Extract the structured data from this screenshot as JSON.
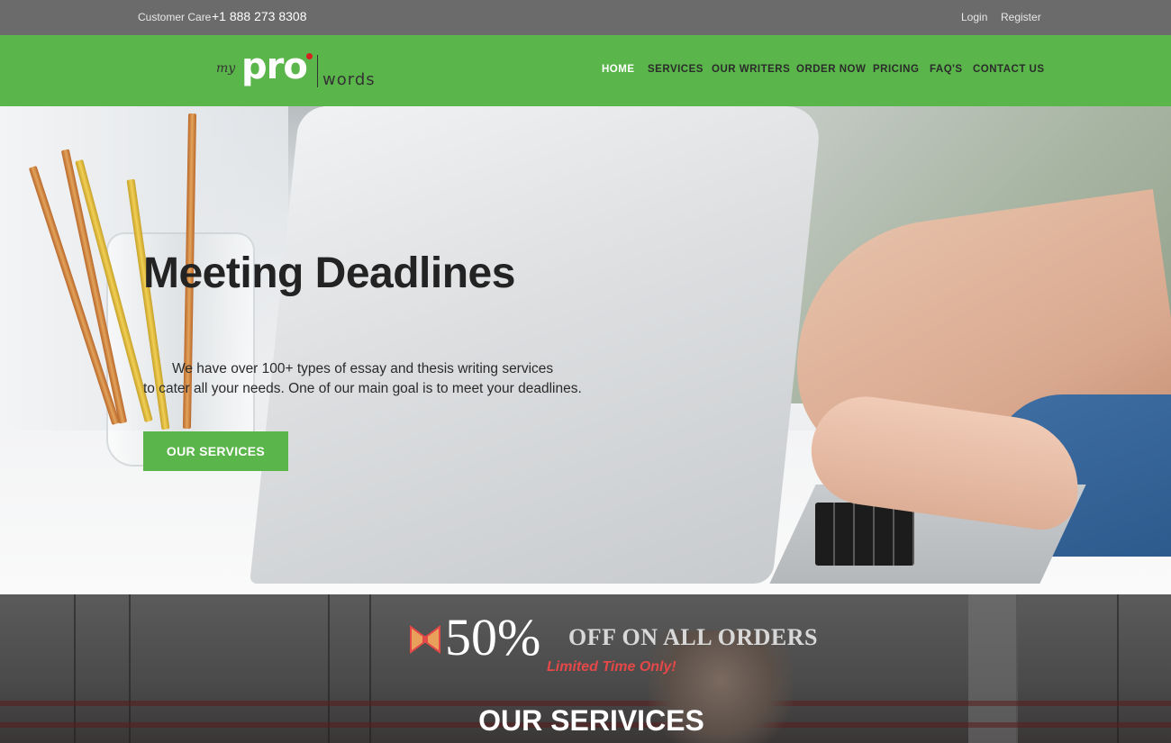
{
  "topbar": {
    "customer_care_label": "Customer Care",
    "phone": "+1 888 273 8308",
    "login": "Login",
    "register": "Register"
  },
  "logo": {
    "my": "my",
    "pro": "pro",
    "words": "words"
  },
  "nav": {
    "items": [
      {
        "label": "HOME",
        "active": true
      },
      {
        "label": "SERVICES",
        "active": false
      },
      {
        "label": "OUR WRITERS",
        "active": false
      },
      {
        "label": "ORDER NOW",
        "active": false
      },
      {
        "label": "PRICING",
        "active": false
      },
      {
        "label": "FAQ'S",
        "active": false
      },
      {
        "label": "CONTACT US",
        "active": false
      }
    ]
  },
  "hero": {
    "title": "Meeting Deadlines",
    "text_line1": "We have over 100+ types of essay and thesis writing services",
    "text_line2": "to cater all your needs. One of our main goal is to meet your deadlines.",
    "button_label": "OUR SERVICES"
  },
  "promo": {
    "percent": "50%",
    "headline": "OFF ON ALL ORDERS",
    "subline": "Limited Time Only!",
    "icon": "bow-ribbon-icon"
  },
  "services_section": {
    "title": "OUR SERIVICES"
  },
  "colors": {
    "brand_green": "#5ab54a",
    "topbar_gray": "#6b6b6b",
    "promo_red": "#e54848"
  }
}
